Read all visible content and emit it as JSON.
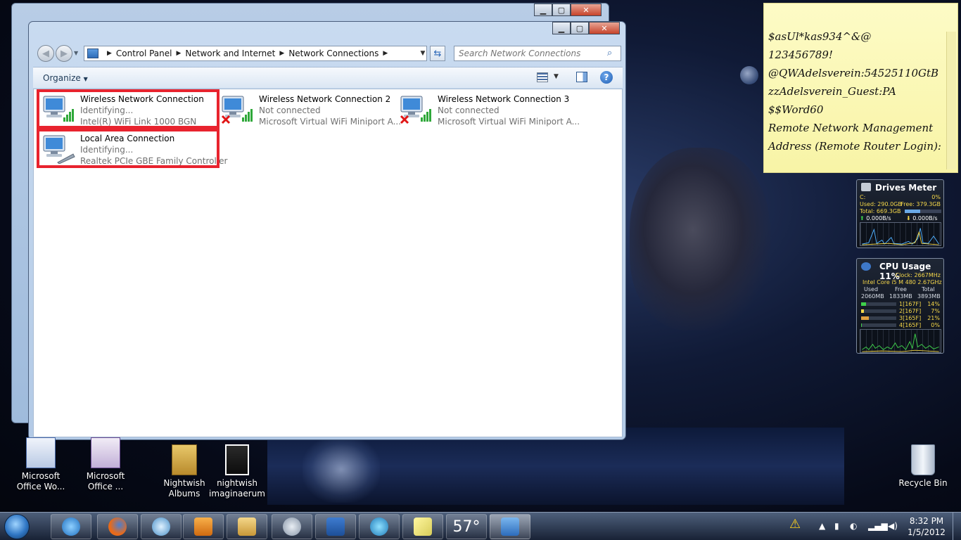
{
  "explorer": {
    "breadcrumb": [
      "Control Panel",
      "Network and Internet",
      "Network Connections"
    ],
    "search_placeholder": "Search Network Connections",
    "toolbar": {
      "organize_label": "Organize"
    },
    "connections": [
      {
        "name": "Wireless Network Connection",
        "status": "Identifying...",
        "device": "Intel(R) WiFi Link 1000 BGN"
      },
      {
        "name": "Wireless Network Connection 2",
        "status": "Not connected",
        "device": "Microsoft Virtual WiFi Miniport A..."
      },
      {
        "name": "Wireless Network Connection 3",
        "status": "Not connected",
        "device": "Microsoft Virtual WiFi Miniport A..."
      },
      {
        "name": "Local Area Connection",
        "status": "Identifying...",
        "device": "Realtek PCIe GBE Family Controller"
      }
    ]
  },
  "sticky_note": {
    "lines": [
      "$asUl*kas934^&@",
      "123456789!",
      "@QWAdelsverein:54525110GtB",
      "zzAdelsverein_Guest:PA",
      "$$Word60",
      "Remote Network Management",
      "Address (Remote Router Login):"
    ]
  },
  "drives_meter": {
    "title": "Drives Meter",
    "drive": "C:",
    "percent": "0%",
    "used": "Used: 290.0GB",
    "free": "Free: 379.3GB",
    "total": "Total: 669.3GB",
    "read": "0.000B/s",
    "write": "0.000B/s",
    "usage_fraction": 0.43
  },
  "cpu_usage": {
    "title": "CPU Usage 11%",
    "clock": "Clock: 2667MHz",
    "processor": "Intel Core i5 M 480 2.67GHz",
    "mem_headers": [
      "Used",
      "Free",
      "Total"
    ],
    "mem_values": [
      "2060MB",
      "1833MB",
      "3893MB"
    ],
    "cores": [
      {
        "label": "1[167F]",
        "pct": "14%",
        "fraction": 0.14
      },
      {
        "label": "2[167F]",
        "pct": "7%",
        "fraction": 0.07
      },
      {
        "label": "3[165F]",
        "pct": "21%",
        "fraction": 0.21
      },
      {
        "label": "4[165F]",
        "pct": "0%",
        "fraction": 0.0
      }
    ]
  },
  "desktop_icons": [
    {
      "label": "Microsoft Office Wo..."
    },
    {
      "label": "Microsoft Office ..."
    },
    {
      "label": "Nightwish Albums"
    },
    {
      "label": "nightwish imaginaerum"
    },
    {
      "label": "Recycle Bin"
    }
  ],
  "taskbar": {
    "weather_temp": "57°",
    "clock_time": "8:32 PM",
    "clock_date": "1/5/2012"
  },
  "colors": {
    "highlight_red": "#e8232e",
    "sticky_yellow": "#fdfbc6"
  }
}
